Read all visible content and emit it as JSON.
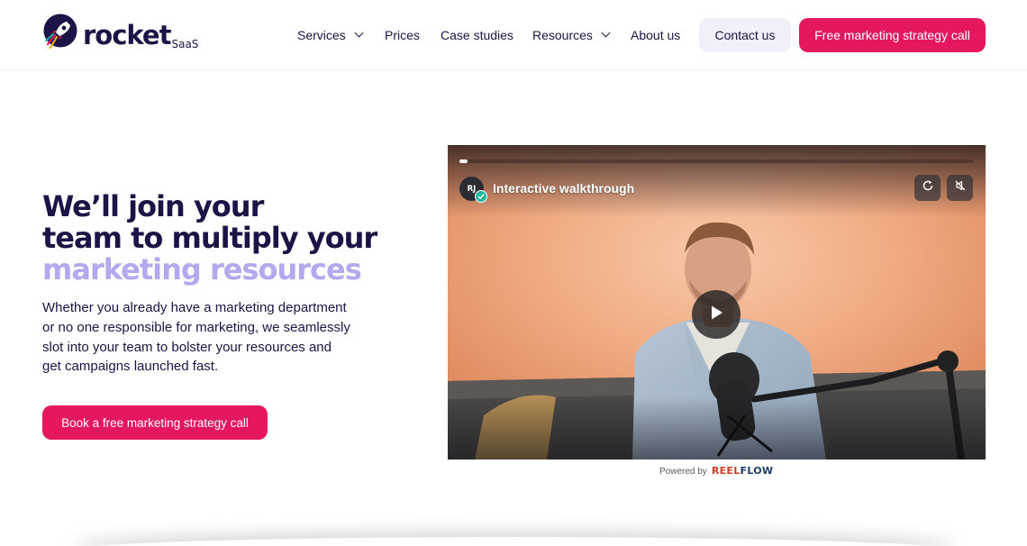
{
  "header": {
    "logo": {
      "word": "rocket",
      "sub": "SaaS"
    },
    "nav": [
      {
        "label": "Services",
        "dropdown": true
      },
      {
        "label": "Prices",
        "dropdown": false
      },
      {
        "label": "Case studies",
        "dropdown": false
      },
      {
        "label": "Resources",
        "dropdown": true
      },
      {
        "label": "About us",
        "dropdown": false
      }
    ],
    "contact_label": "Contact us",
    "cta_label": "Free marketing strategy call"
  },
  "hero": {
    "headline_line1": "We’ll join your",
    "headline_line2": "team to multiply your",
    "headline_accent": "marketing resources",
    "body": "Whether you already have a marketing department or no one responsible for marketing, we seamlessly slot into your team to bolster your resources and get campaigns launched fast.",
    "cta_label": "Book a free marketing strategy call"
  },
  "video": {
    "avatar_initials": "RJ",
    "title": "Interactive walkthrough",
    "progress": 0.015,
    "powered_by": "Powered by",
    "brand_part1": "REEL",
    "brand_part2": "FLOW"
  },
  "colors": {
    "navy": "#1b1446",
    "accent_pink": "#e5185f",
    "lavender": "#b6a8ef",
    "contact_bg": "#f1f0f8"
  },
  "icons": {
    "logo": "rocket-icon",
    "replay": "replay-icon",
    "mute": "mute-icon",
    "play": "play-icon",
    "verified": "check-badge-icon"
  }
}
